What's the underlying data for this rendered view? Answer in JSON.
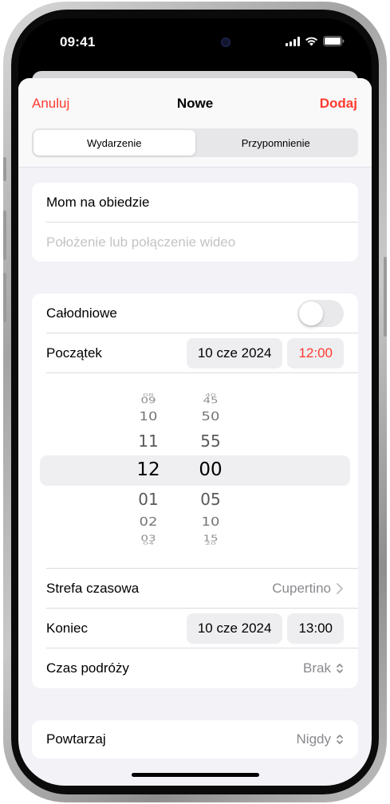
{
  "status_bar": {
    "time": "09:41"
  },
  "nav": {
    "cancel": "Anuluj",
    "title": "Nowe",
    "add": "Dodaj"
  },
  "segments": [
    {
      "label": "Wydarzenie",
      "selected": true
    },
    {
      "label": "Przypomnienie",
      "selected": false
    }
  ],
  "event": {
    "title_value": "Mom na obiedzie",
    "location_placeholder": "Położenie lub połączenie wideo"
  },
  "all_day": {
    "label": "Całodniowe",
    "on": false
  },
  "start": {
    "label": "Początek",
    "date": "10 cze 2024",
    "time": "12:00"
  },
  "picker": {
    "hours": [
      "08",
      "09",
      "10",
      "11",
      "12",
      "01",
      "02",
      "03",
      "04"
    ],
    "minutes": [
      "40",
      "45",
      "50",
      "55",
      "00",
      "05",
      "10",
      "15",
      "20"
    ]
  },
  "timezone": {
    "label": "Strefa czasowa",
    "value": "Cupertino"
  },
  "end": {
    "label": "Koniec",
    "date": "10 cze 2024",
    "time": "13:00"
  },
  "travel": {
    "label": "Czas podróży",
    "value": "Brak"
  },
  "repeat": {
    "label": "Powtarzaj",
    "value": "Nigdy"
  },
  "colors": {
    "accent": "#ff3b30",
    "background": "#f2f2f7"
  }
}
